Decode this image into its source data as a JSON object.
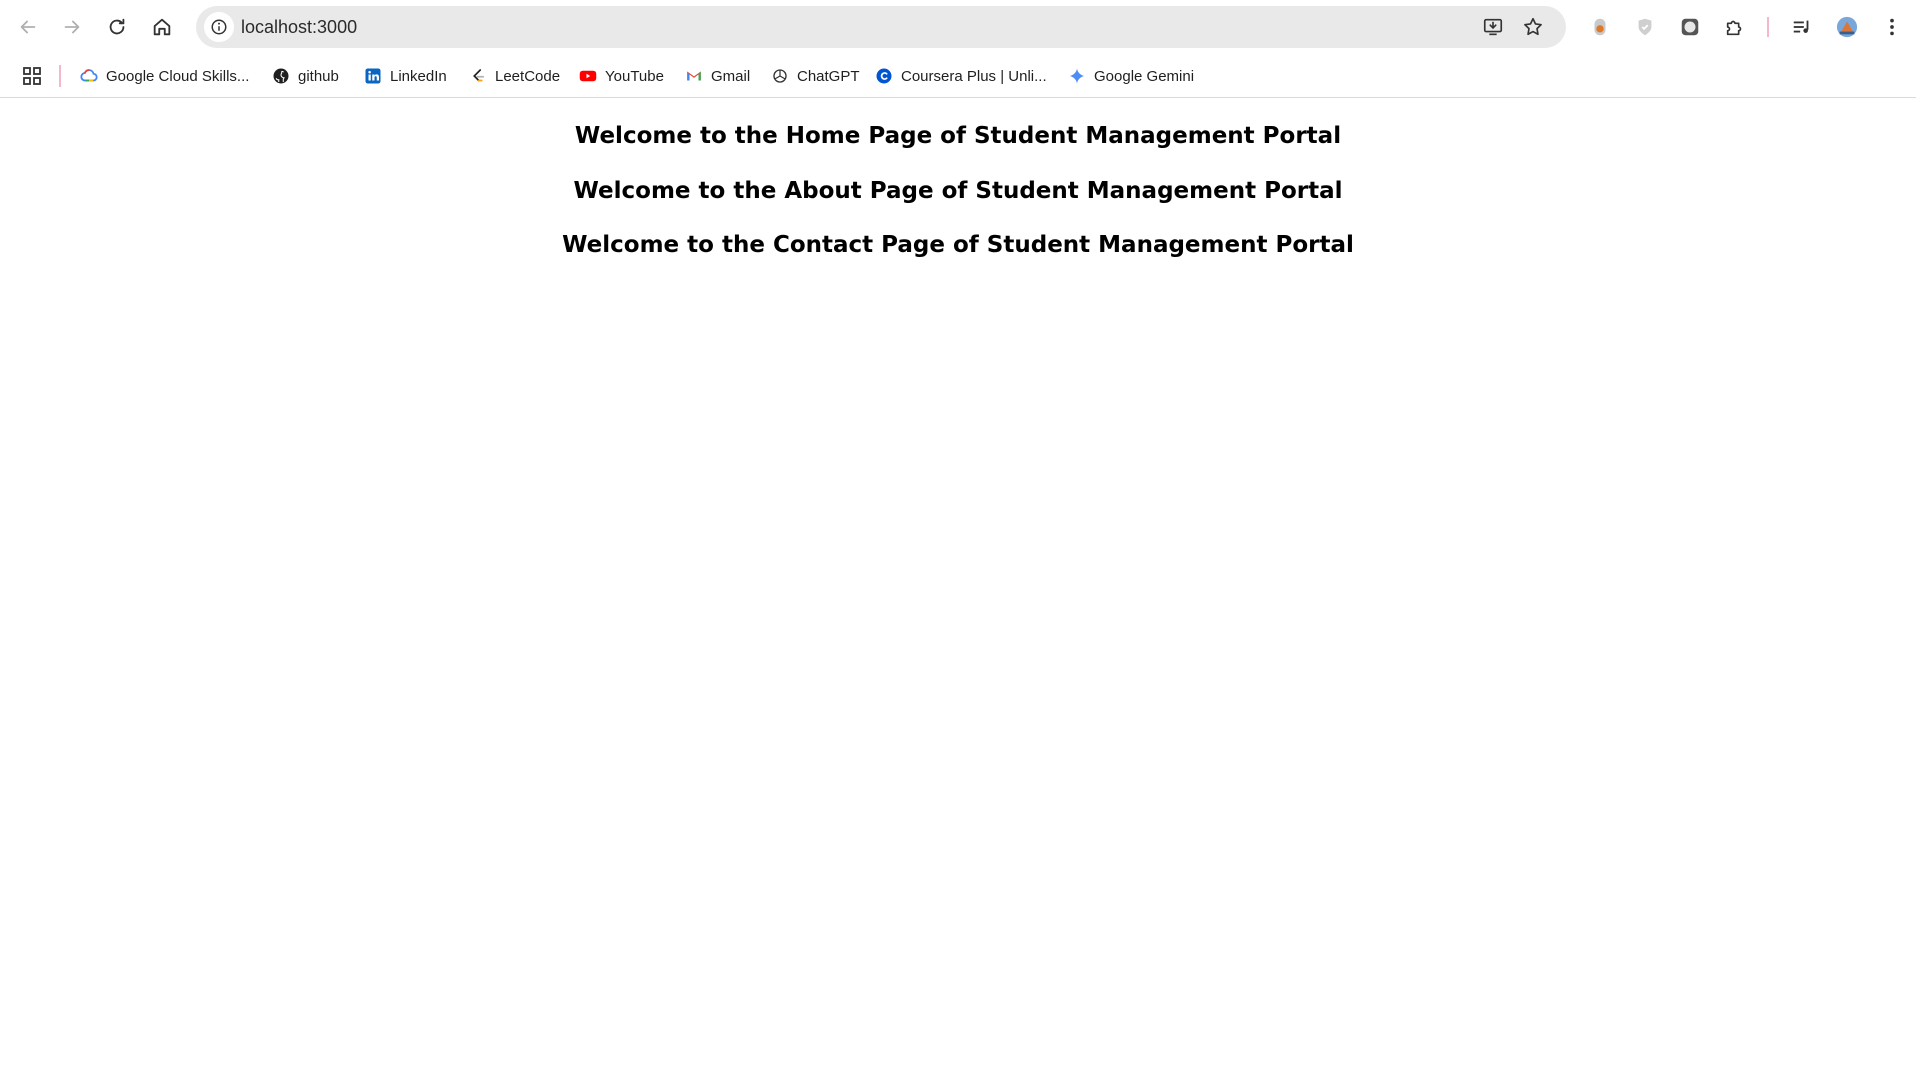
{
  "browser": {
    "address_bar": {
      "url": "localhost:3000"
    },
    "nav_icons": [
      "back-icon",
      "forward-icon",
      "reload-icon",
      "home-icon"
    ],
    "extension_icons": [
      "extension-orange-icon",
      "extension-shield-icon",
      "extension-square-icon",
      "puzzle-icon",
      "media-icon",
      "profile-avatar",
      "menu-icon"
    ]
  },
  "bookmarks": {
    "items": [
      {
        "label": "Google Cloud Skills...",
        "icon": "google-cloud-icon"
      },
      {
        "label": "github",
        "icon": "github-icon"
      },
      {
        "label": "LinkedIn",
        "icon": "linkedin-icon"
      },
      {
        "label": "LeetCode",
        "icon": "leetcode-icon"
      },
      {
        "label": "YouTube",
        "icon": "youtube-icon"
      },
      {
        "label": "Gmail",
        "icon": "gmail-icon"
      },
      {
        "label": "ChatGPT",
        "icon": "chatgpt-icon"
      },
      {
        "label": "Coursera Plus | Unli...",
        "icon": "coursera-icon"
      },
      {
        "label": "Google Gemini",
        "icon": "gemini-icon"
      }
    ]
  },
  "page": {
    "headings": [
      "Welcome to the Home Page of Student Management Portal",
      "Welcome to the About Page of Student Management Portal",
      "Welcome to the Contact Page of Student Management Portal"
    ]
  },
  "colors": {
    "omnibox_bg": "#e9e9e9",
    "separator": "#f4b7cc",
    "heading_text": "#000000"
  }
}
